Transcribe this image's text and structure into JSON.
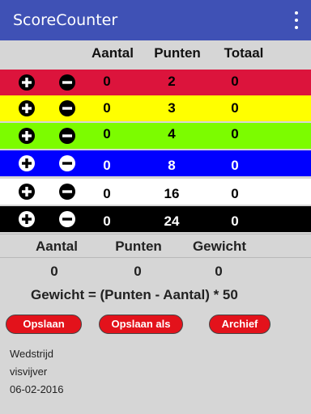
{
  "appbar": {
    "title": "ScoreCounter",
    "menu_icon": "overflow-menu-icon"
  },
  "table": {
    "headers": {
      "aantal": "Aantal",
      "punten": "Punten",
      "totaal": "Totaal"
    },
    "rows": [
      {
        "color": "#dc143c",
        "text_color": "#000000",
        "icon_style": "dark",
        "aantal": "0",
        "punten": "2",
        "totaal": "0"
      },
      {
        "color": "#ffff00",
        "text_color": "#000000",
        "icon_style": "dark",
        "aantal": "0",
        "punten": "3",
        "totaal": "0"
      },
      {
        "color": "#7cfc00",
        "text_color": "#000000",
        "icon_style": "dark",
        "aantal": "0",
        "punten": "4",
        "totaal": "0"
      },
      {
        "color": "#0000ff",
        "text_color": "#ffffff",
        "icon_style": "light",
        "aantal": "0",
        "punten": "8",
        "totaal": "0"
      },
      {
        "color": "#ffffff",
        "text_color": "#000000",
        "icon_style": "dark",
        "aantal": "0",
        "punten": "16",
        "totaal": "0"
      },
      {
        "color": "#000000",
        "text_color": "#ffffff",
        "icon_style": "light",
        "aantal": "0",
        "punten": "24",
        "totaal": "0"
      }
    ]
  },
  "summary": {
    "headers": {
      "aantal": "Aantal",
      "punten": "Punten",
      "gewicht": "Gewicht"
    },
    "values": {
      "aantal": "0",
      "punten": "0",
      "gewicht": "0"
    },
    "formula": "Gewicht = (Punten - Aantal) * 50"
  },
  "buttons": {
    "save": "Opslaan",
    "save_as": "Opslaan als",
    "archive": "Archief"
  },
  "info": {
    "line1": "Wedstrijd",
    "line2": "visvijver",
    "line3": "06-02-2016"
  },
  "colors": {
    "appbar": "#3f51b5",
    "button": "#e3121b",
    "background": "#d6d6d6"
  }
}
